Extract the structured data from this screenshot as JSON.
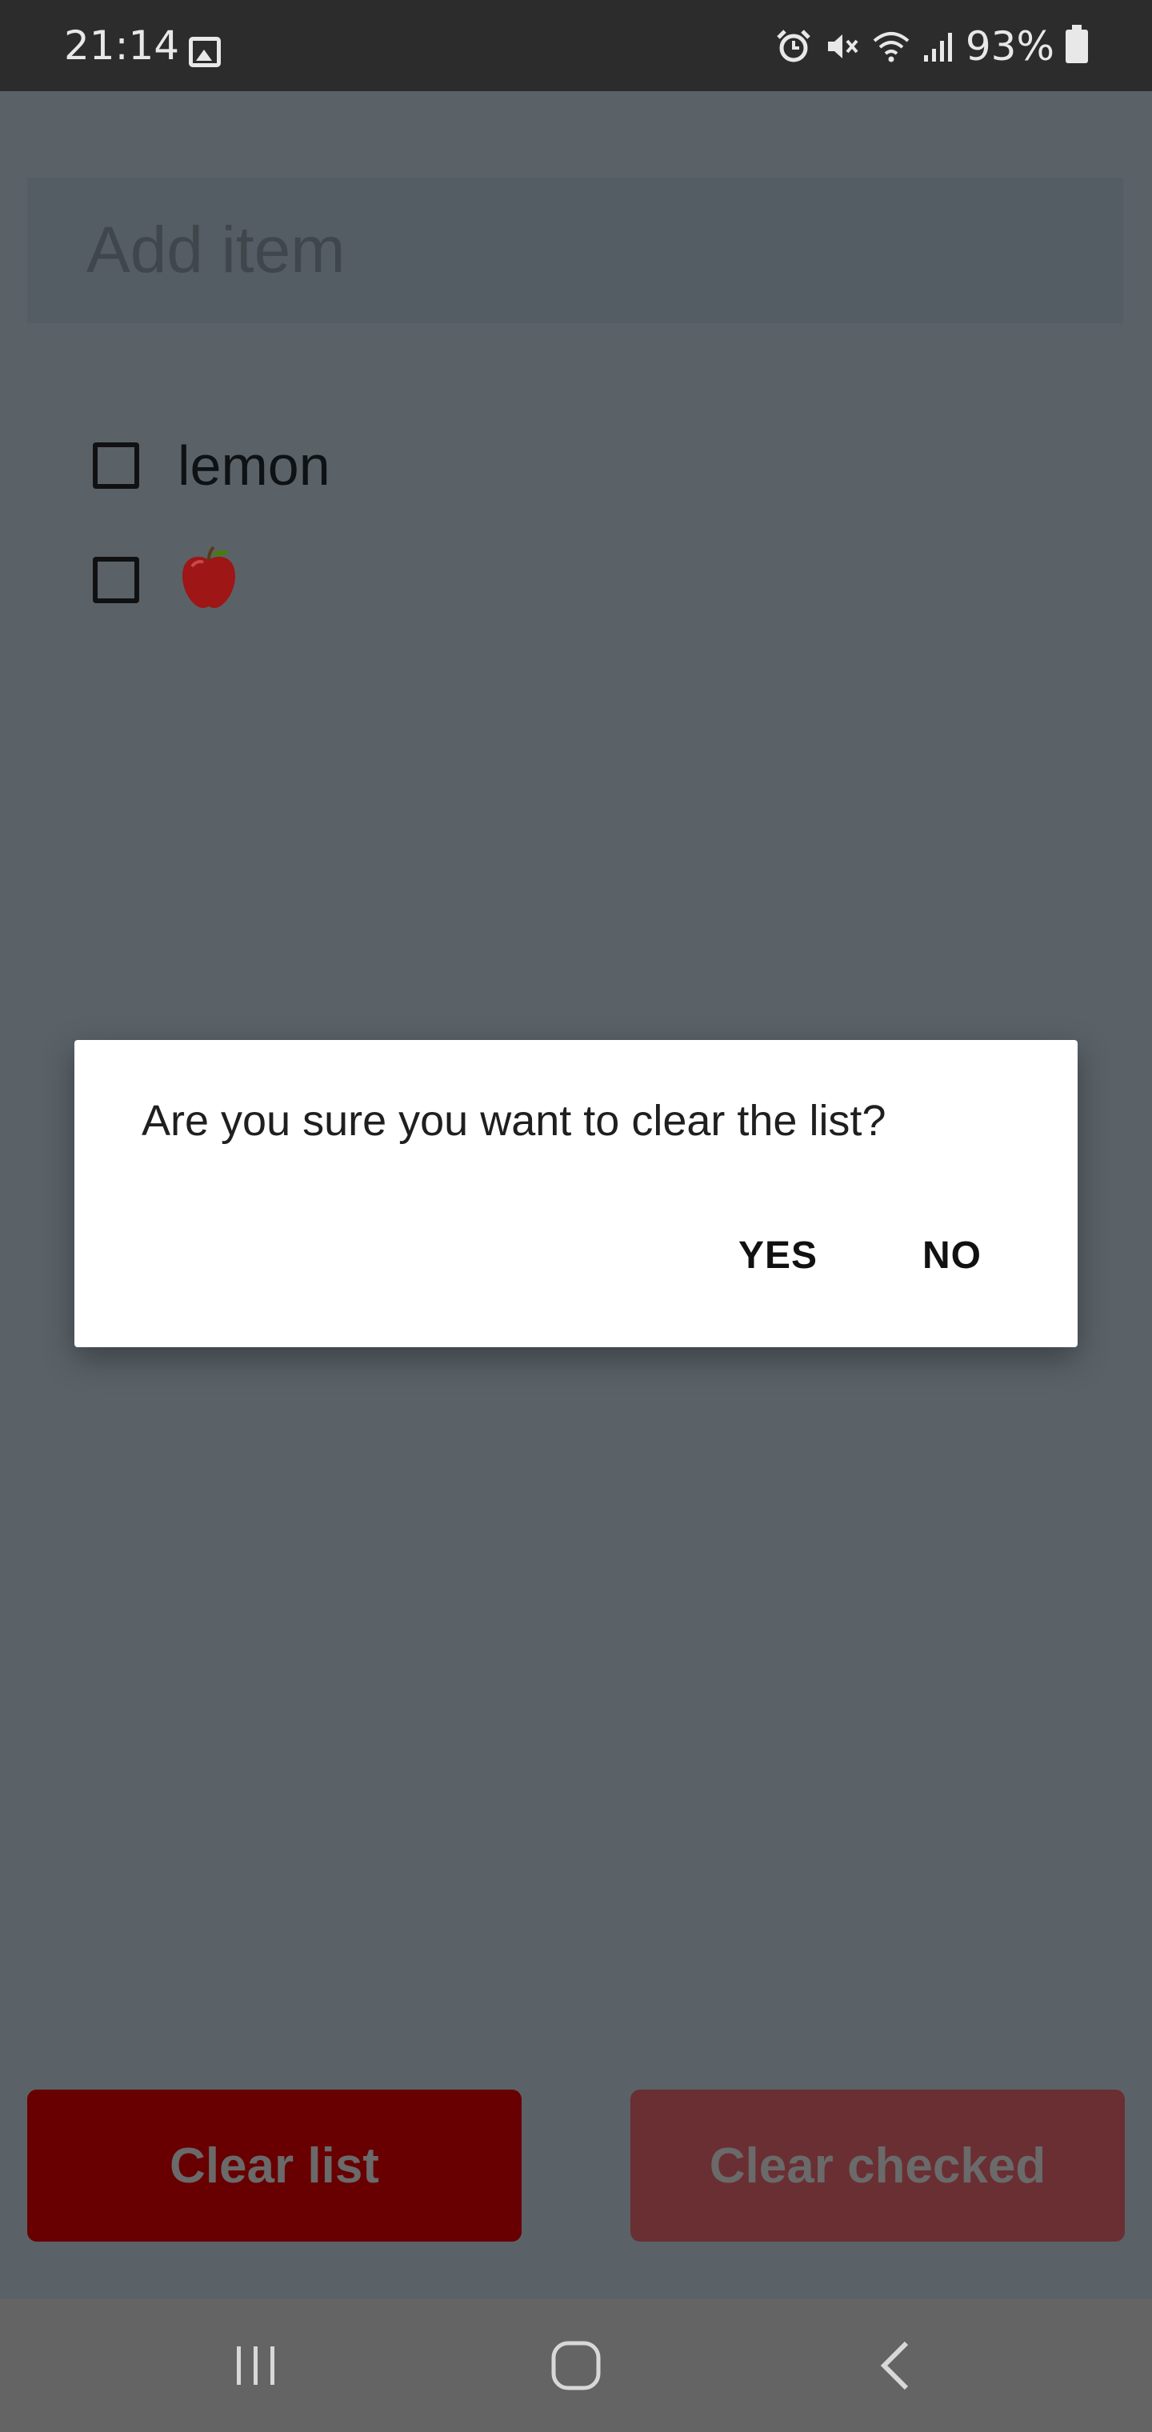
{
  "status_bar": {
    "time": "21:14",
    "battery_percent": "93%",
    "icons": [
      "gallery-icon",
      "alarm-icon",
      "mute-icon",
      "wifi-icon",
      "signal-icon",
      "battery-icon"
    ]
  },
  "add_item": {
    "placeholder": "Add item",
    "value": ""
  },
  "list": {
    "items": [
      {
        "label": "lemon",
        "checked": false
      },
      {
        "label": "🍎",
        "checked": false
      }
    ]
  },
  "dialog": {
    "message": "Are you sure you want to clear the list?",
    "yes_label": "YES",
    "no_label": "NO"
  },
  "buttons": {
    "clear_list": "Clear list",
    "clear_checked": "Clear checked"
  },
  "colors": {
    "scrim_background": "#5a6268",
    "clear_list_bg": "#680002",
    "clear_checked_bg": "#6a2f33",
    "dialog_bg": "#ffffff"
  }
}
